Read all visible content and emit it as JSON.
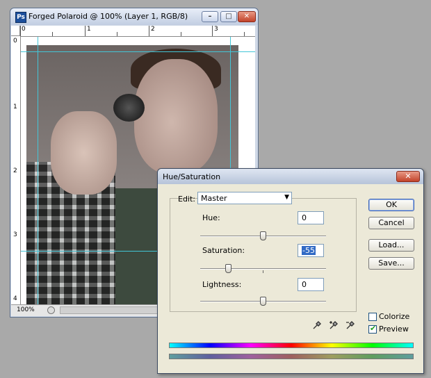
{
  "document": {
    "title": "Forged Polaroid @ 100% (Layer 1, RGB/8)",
    "app_badge": "Ps",
    "ruler_h_labels": [
      "0",
      "1",
      "2",
      "3"
    ],
    "ruler_v_labels": [
      "0",
      "1",
      "2",
      "3",
      "4"
    ],
    "zoom": "100%",
    "buttons": {
      "minimize": "–",
      "maximize": "□",
      "close": "✕"
    }
  },
  "dialog": {
    "title": "Hue/Saturation",
    "close": "✕",
    "edit_label": "Edit:",
    "edit_value": "Master",
    "hue": {
      "label": "Hue:",
      "value": "0",
      "level": 0
    },
    "saturation": {
      "label": "Saturation:",
      "value": "-55",
      "level": -55
    },
    "lightness": {
      "label": "Lightness:",
      "value": "0",
      "level": 0
    },
    "buttons": {
      "ok": "OK",
      "cancel": "Cancel",
      "load": "Load...",
      "save": "Save..."
    },
    "colorize": {
      "label": "Colorize",
      "checked": false
    },
    "preview": {
      "label": "Preview",
      "checked": true
    }
  },
  "icons": {
    "dropper": "eyedropper-icon",
    "dropper_plus": "eyedropper-plus-icon",
    "dropper_minus": "eyedropper-minus-icon"
  }
}
